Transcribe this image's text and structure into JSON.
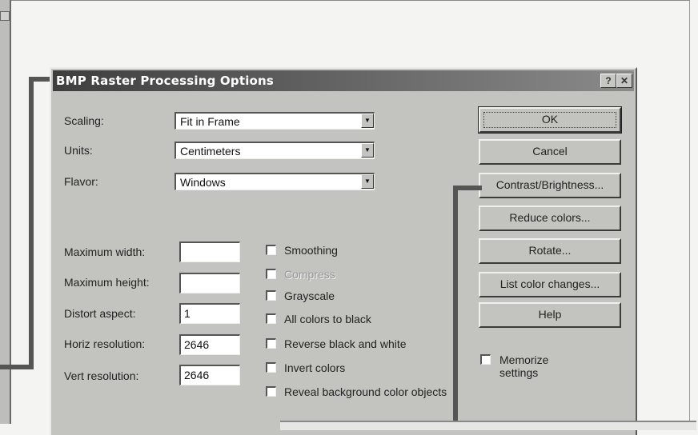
{
  "dialog": {
    "title": "BMP Raster Processing Options",
    "help_btn": "?",
    "close_btn": "✕"
  },
  "options": {
    "scaling": {
      "label": "Scaling:",
      "value": "Fit in Frame"
    },
    "units": {
      "label": "Units:",
      "value": "Centimeters"
    },
    "flavor": {
      "label": "Flavor:",
      "value": "Windows"
    }
  },
  "fields": {
    "max_width": {
      "label": "Maximum width:",
      "value": ""
    },
    "max_height": {
      "label": "Maximum height:",
      "value": ""
    },
    "distort_aspect": {
      "label": "Distort aspect:",
      "value": "1"
    },
    "horiz_res": {
      "label": "Horiz resolution:",
      "value": "2646"
    },
    "vert_res": {
      "label": "Vert resolution:",
      "value": "2646"
    }
  },
  "checkboxes": {
    "smoothing": "Smoothing",
    "compress": "Compress",
    "grayscale": "Grayscale",
    "all_colors_black": "All colors to black",
    "reverse_bw": "Reverse black and white",
    "invert_colors": "Invert colors",
    "reveal_bg": "Reveal background color objects"
  },
  "buttons": {
    "ok": "OK",
    "cancel": "Cancel",
    "contrast": "Contrast/Brightness...",
    "reduce_colors": "Reduce colors...",
    "rotate": "Rotate...",
    "list_color_changes": "List color changes...",
    "help": "Help"
  },
  "memorize": "Memorize settings"
}
